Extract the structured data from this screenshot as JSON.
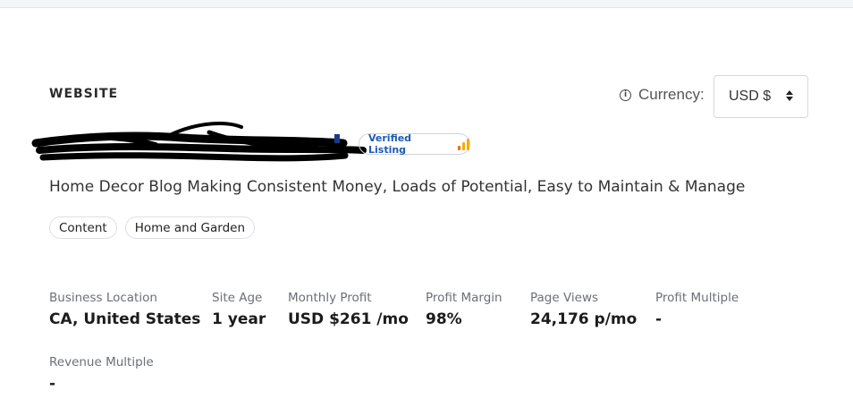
{
  "section_label": "WEBSITE",
  "currency": {
    "label": "Currency:",
    "selected": "USD $"
  },
  "listing": {
    "badge_label": "Verified Listing",
    "subtitle": "Home Decor Blog Making Consistent Money, Loads of Potential, Easy to Maintain & Manage",
    "tags": [
      "Content",
      "Home and Garden"
    ]
  },
  "metrics": [
    {
      "label": "Business Location",
      "value": "CA, United States"
    },
    {
      "label": "Site Age",
      "value": "1 year"
    },
    {
      "label": "Monthly Profit",
      "value": "USD $261 /mo"
    },
    {
      "label": "Profit Margin",
      "value": "98%"
    },
    {
      "label": "Page Views",
      "value": "24,176 p/mo"
    },
    {
      "label": "Profit Multiple",
      "value": "-"
    },
    {
      "label": "Revenue Multiple",
      "value": "-"
    }
  ],
  "icons": {
    "info": "info-icon",
    "select": "sort-icon",
    "badge": "analytics-icon"
  },
  "colors": {
    "badge_text": "#1f5bb5",
    "analytics_orange": "#f9ab00",
    "analytics_dark": "#e37400"
  }
}
